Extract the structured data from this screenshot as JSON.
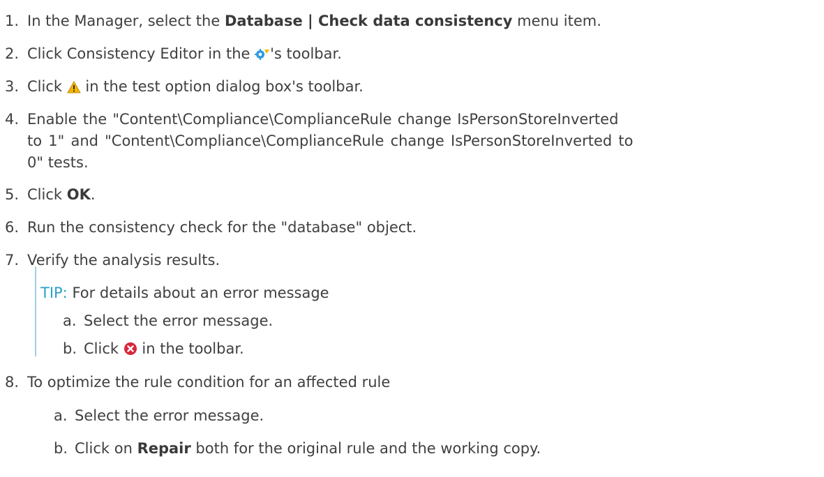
{
  "steps": [
    {
      "number": "1.",
      "pre": "In the Manager, select the ",
      "bold": "Database | Check data consistency",
      "post": " menu item."
    },
    {
      "number": "2.",
      "pre": "Click Consistency Editor in the ",
      "icon": "consistency-editor-icon",
      "post": "'s toolbar."
    },
    {
      "number": "3.",
      "pre": "Click ",
      "icon": "warning-icon",
      "post": " in the test option dialog box's toolbar."
    },
    {
      "number": "4.",
      "lines": [
        "Enable the \"Content\\Compliance\\ComplianceRule change IsPersonStoreInverted",
        "to 1\" and \"Content\\Compliance\\ComplianceRule change IsPersonStoreInverted to",
        "0\" tests."
      ]
    },
    {
      "number": "5.",
      "pre": "Click ",
      "bold": "OK",
      "post": "."
    },
    {
      "number": "6.",
      "text": "Run the consistency check for the \"database\" object."
    },
    {
      "number": "7.",
      "text": "Verify the analysis results.",
      "tip": {
        "label": "TIP:",
        "text": " For details about an error message",
        "substeps": [
          {
            "letter": "a.",
            "text": "Select the error message."
          },
          {
            "letter": "b.",
            "pre": "Click ",
            "icon": "error-icon",
            "post": " in the toolbar."
          }
        ]
      }
    },
    {
      "number": "8.",
      "text": "To optimize the rule condition for an affected rule",
      "substeps": [
        {
          "letter": "a.",
          "text": "Select the error message."
        },
        {
          "letter": "b.",
          "pre": "Click on ",
          "bold": "Repair",
          "post": " both for the original rule and the working copy."
        }
      ]
    }
  ],
  "colors": {
    "text": "#3f3f3f",
    "tip": "#2aa0c8",
    "tip_bar": "#9fd0e6",
    "warning": "#f2b705",
    "error": "#d7263d",
    "editor_icon": "#2b9be0"
  }
}
